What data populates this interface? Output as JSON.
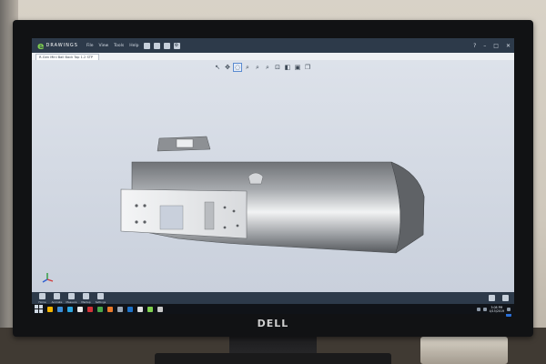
{
  "app": {
    "logo_mark": "e",
    "logo_text": "DRAWINGS",
    "menu": [
      "File",
      "View",
      "Tools",
      "Help"
    ],
    "window_controls": [
      "?",
      "–",
      "□",
      "✕"
    ],
    "tab_label": "R-Gen Mini Ball Back Top 1.2 STP"
  },
  "view_toolbar": {
    "icons": [
      "select-icon",
      "pan-icon",
      "rotate-icon",
      "zoom-window-icon",
      "zoom-area-icon",
      "zoom-icon",
      "zoom-fit-icon",
      "section-icon",
      "display-style-icon",
      "view-orientation-icon"
    ]
  },
  "bottom_toolbar": {
    "items": [
      "Home",
      "Animate",
      "Measure",
      "Markup",
      "Settings"
    ]
  },
  "taskbar": {
    "time": "3:08 PM",
    "date": "4/15/2019",
    "icon_colors": [
      "#f4b400",
      "#3b8ed9",
      "#2ca5e0",
      "#e8e8e8",
      "#d13438",
      "#4aa84a",
      "#e97a2b",
      "#9aa6b4",
      "#1e73c8",
      "#dddddd",
      "#7fd14f",
      "#c7c7c7"
    ]
  },
  "brand": {
    "monitor": "DELL"
  },
  "colors": {
    "titlebar": "#2d3a4a",
    "accent": "#7fd14f",
    "viewport_top": "#dde2ea",
    "viewport_bottom": "#c9d0dc"
  }
}
